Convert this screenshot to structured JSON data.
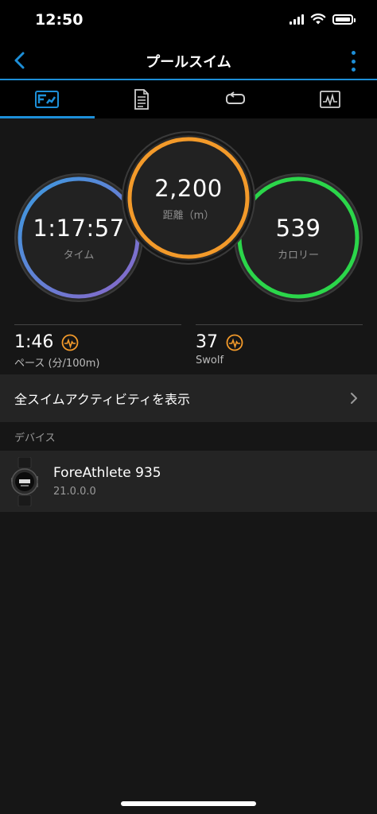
{
  "status_bar": {
    "time": "12:50"
  },
  "nav": {
    "title": "プールスイム"
  },
  "colors": {
    "accent": "#1d8fd8",
    "time_ring_start": "#3a9be0",
    "time_ring_end": "#8a66c9",
    "distance_ring": "#f39a2a",
    "calories_ring": "#2bd64a",
    "hr_icon": "#f39a2a"
  },
  "tabs": [
    {
      "icon": "summary-icon"
    },
    {
      "icon": "details-icon"
    },
    {
      "icon": "laps-icon"
    },
    {
      "icon": "chart-icon"
    }
  ],
  "stats": {
    "time": {
      "value": "1:17:57",
      "label": "タイム"
    },
    "distance": {
      "value": "2,200",
      "label": "距離（m）"
    },
    "calories": {
      "value": "539",
      "label": "カロリー"
    }
  },
  "metrics": {
    "pace": {
      "value": "1:46",
      "label": "ペース (分/100m)"
    },
    "swolf": {
      "value": "37",
      "label": "Swolf"
    }
  },
  "all_activities": {
    "label": "全スイムアクティビティを表示"
  },
  "devices_section": {
    "header": "デバイス"
  },
  "device": {
    "name": "ForeAthlete 935",
    "version": "21.0.0.0"
  }
}
